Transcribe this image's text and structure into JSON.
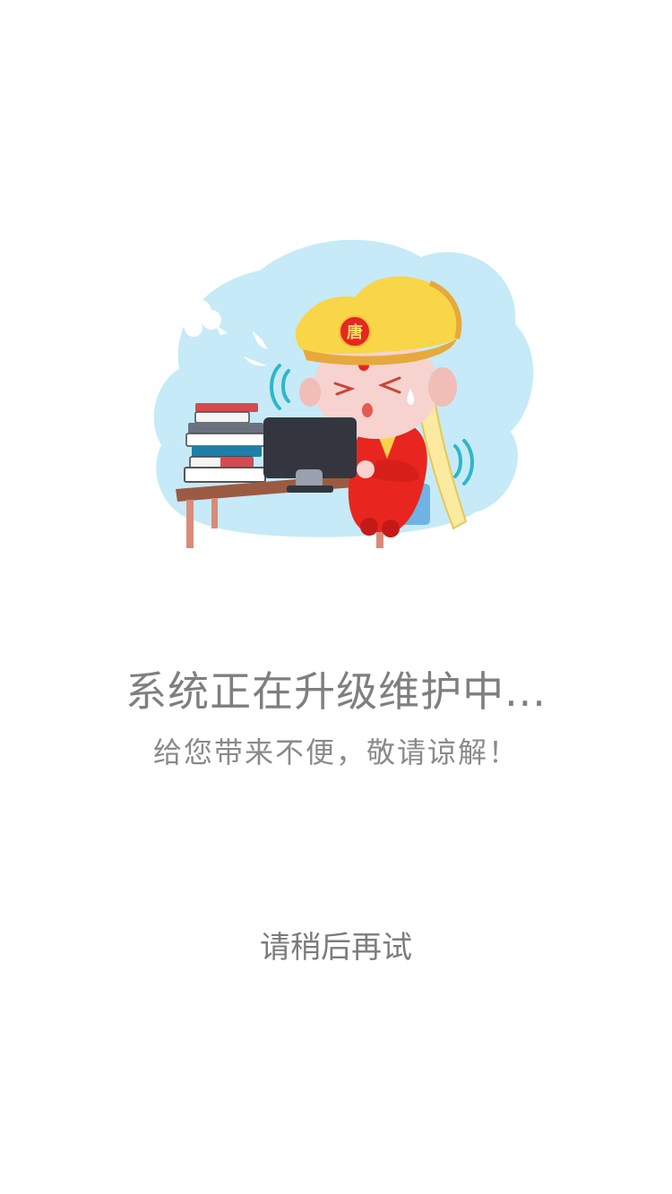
{
  "main": {
    "title": "系统正在升级维护中...",
    "subtitle": "给您带来不便，敬请谅解！",
    "retry_label": "请稍后再试"
  },
  "illustration": {
    "badge_char": "唐",
    "colors": {
      "cloud": "#c6eaf7",
      "hat": "#f9d548",
      "hat_shadow": "#e7a93b",
      "robe": "#e8261f",
      "desk": "#9a5b42",
      "monitor": "#33363f",
      "skin": "#f7d3cf",
      "ribbon": "#fbeaa0"
    }
  },
  "theme": {
    "background": "#ffffff",
    "text_gray": "#808080"
  }
}
